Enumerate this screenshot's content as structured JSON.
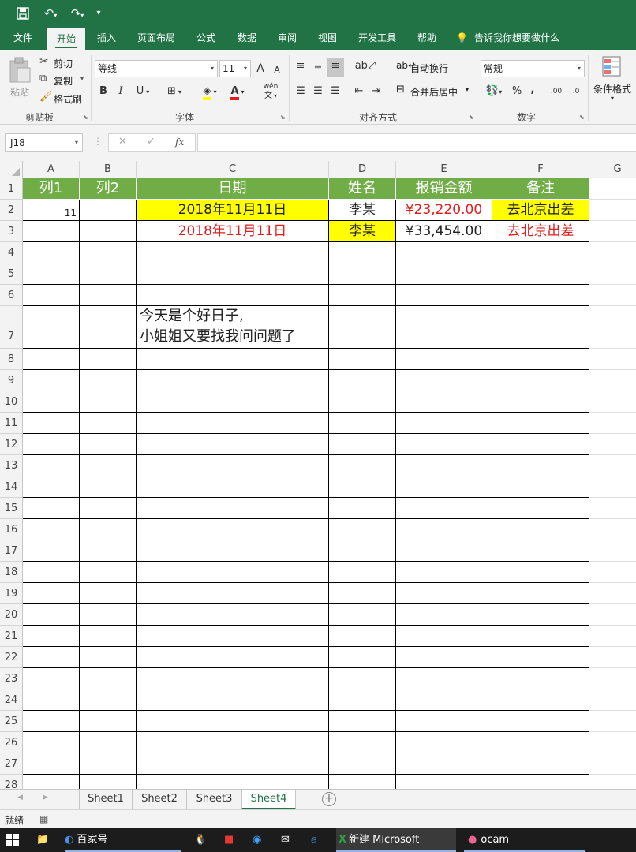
{
  "qat": {
    "save": "💾",
    "undo": "↶",
    "redo": "↷",
    "customize": "▾"
  },
  "tabs": [
    "文件",
    "开始",
    "插入",
    "页面布局",
    "公式",
    "数据",
    "审阅",
    "视图",
    "开发工具",
    "帮助"
  ],
  "active_tab": "开始",
  "tell_me": "告诉我你想要做什么",
  "ribbon": {
    "clipboard": {
      "paste": "粘贴",
      "cut": "剪切",
      "copy": "复制",
      "format_painter": "格式刷",
      "label": "剪贴板"
    },
    "font": {
      "font_name": "等线",
      "font_size": "11",
      "grow": "A",
      "shrink": "A",
      "bold": "B",
      "italic": "I",
      "underline": "U",
      "phonetic": "wén",
      "label": "字体"
    },
    "alignment": {
      "wrap_text": "自动换行",
      "merge_center": "合并后居中",
      "label": "对齐方式"
    },
    "number": {
      "format": "常规",
      "percent": "%",
      "comma": ",",
      "inc_decimal": ".00",
      "dec_decimal": ".0",
      "label": "数字"
    },
    "styles": {
      "conditional_format": "条件格式"
    }
  },
  "formula_bar": {
    "name_box": "J18",
    "fx": "fx",
    "cancel": "✕",
    "enter": "✓",
    "content": ""
  },
  "columns": [
    "A",
    "B",
    "C",
    "D",
    "E",
    "F",
    "G"
  ],
  "rows": [
    "1",
    "2",
    "3",
    "4",
    "5",
    "6",
    "7",
    "8",
    "9",
    "10",
    "11",
    "12",
    "13",
    "14",
    "15",
    "16",
    "17",
    "18",
    "19",
    "20",
    "21",
    "22",
    "23",
    "24",
    "25",
    "26",
    "27",
    "28"
  ],
  "sheet": {
    "headers": [
      "列1",
      "列2",
      "日期",
      "姓名",
      "报销金额",
      "备注"
    ],
    "row2": {
      "a": "11",
      "c": "2018年11月11日",
      "d": "李某",
      "e": "¥23,220.00",
      "f": "去北京出差"
    },
    "row3": {
      "c": "2018年11月11日",
      "d": "李某",
      "e": "¥33,454.00",
      "f": "去北京出差"
    },
    "row7_line1": "今天是个好日子,",
    "row7_line2": "小姐姐又要找我问问题了"
  },
  "sheet_tabs": [
    "Sheet1",
    "Sheet2",
    "Sheet3",
    "Sheet4"
  ],
  "active_sheet": "Sheet4",
  "status": {
    "ready": "就绪"
  },
  "taskbar": {
    "baijiahao": "百家号",
    "excel": "新建 Microsoft Exce...",
    "ocam": "ocam"
  },
  "colors": {
    "excel_green": "#217346",
    "header_green": "#70ad47",
    "highlight_yellow": "#ffff00",
    "red_text": "#e21c1c"
  }
}
